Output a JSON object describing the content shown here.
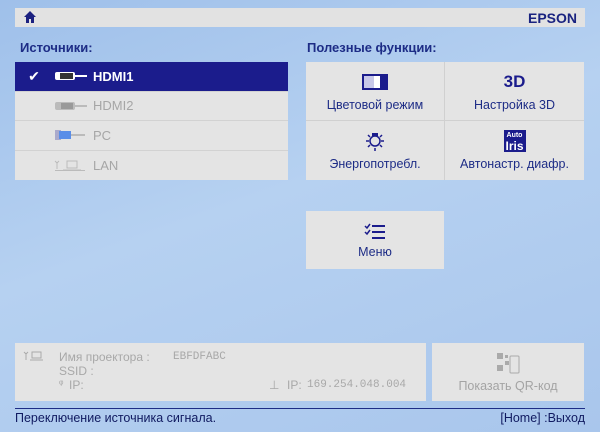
{
  "header": {
    "brand": "EPSON"
  },
  "sources": {
    "title": "Источники:",
    "items": [
      {
        "label": "HDMI1",
        "selected": true
      },
      {
        "label": "HDMI2",
        "selected": false
      },
      {
        "label": "PC",
        "selected": false
      },
      {
        "label": "LAN",
        "selected": false
      }
    ]
  },
  "functions": {
    "title": "Полезные функции:",
    "items": [
      {
        "label": "Цветовой режим",
        "icon": "color-mode-icon"
      },
      {
        "label": "Настройка 3D",
        "icon": "3d-icon"
      },
      {
        "label": "Энергопотребл.",
        "icon": "lamp-icon"
      },
      {
        "label": "Автонастр. диафр.",
        "icon": "auto-iris-icon"
      }
    ],
    "icon_3d_text": "3D",
    "iris_auto": "Auto",
    "iris_text": "Iris"
  },
  "menu": {
    "label": "Меню"
  },
  "info": {
    "projector_name_label": "Имя проектора :",
    "projector_name": "EBFDFABC",
    "ssid_label": "SSID :",
    "wifi_ip_label": "IP:",
    "wired_ip_label": "IP:",
    "wired_ip": "169.254.048.004"
  },
  "qr": {
    "label": "Показать QR-код"
  },
  "statusbar": {
    "message": "Переключение источника сигнала.",
    "exit_hint": "[Home] :Выход"
  },
  "colors": {
    "accent": "#1b1c8c",
    "text": "#1d2c86",
    "panel": "#e4e4e4"
  }
}
